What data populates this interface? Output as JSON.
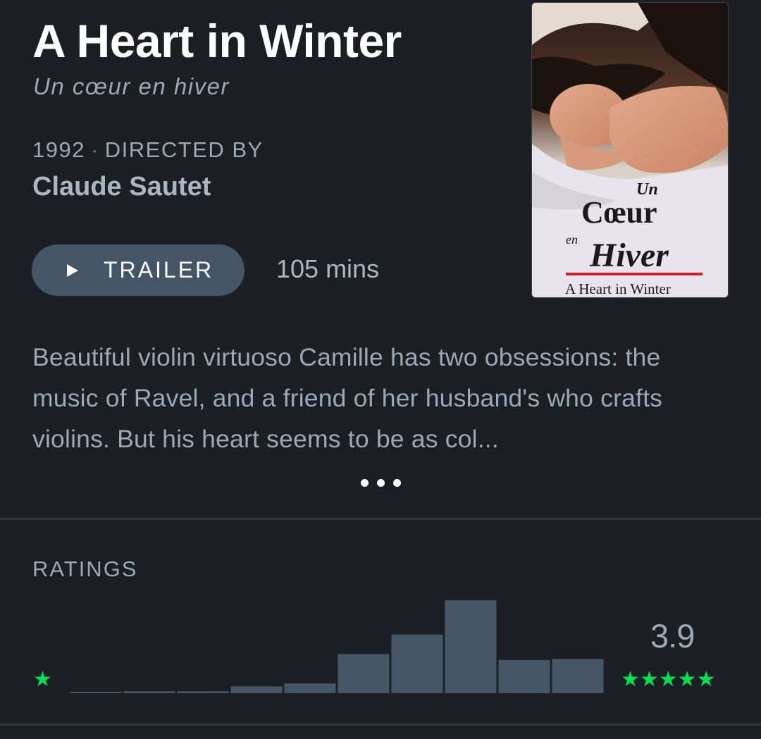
{
  "film": {
    "title": "A Heart in Winter",
    "original_title": "Un cœur en hiver",
    "year": "1992",
    "directed_by_label": "DIRECTED BY",
    "director": "Claude Sautet",
    "trailer_label": "TRAILER",
    "runtime": "105 mins",
    "synopsis": "Beautiful violin virtuoso Camille has two obsessions: the music of Ravel, and a friend of her husband's who crafts violins. But his heart seems to be as col...",
    "poster": {
      "line_un": "Un",
      "line_coeur": "Cœur",
      "line_en": "en",
      "line_hiver": "Hiver",
      "line_english": "A Heart in Winter"
    }
  },
  "ratings": {
    "label": "RATINGS",
    "average": "3.9",
    "low_star": "★",
    "high_stars": "★★★★★",
    "star_color": "#00e054",
    "bar_color": "#445566"
  },
  "chart_data": {
    "type": "bar",
    "categories": [
      "0.5",
      "1",
      "1.5",
      "2",
      "2.5",
      "3",
      "3.5",
      "4",
      "4.5",
      "5"
    ],
    "values": [
      1,
      2,
      2,
      7,
      10,
      40,
      60,
      95,
      34,
      35
    ],
    "ylim": [
      0,
      95
    ]
  },
  "icons": {
    "play": "play-icon",
    "more": "ellipsis-icon",
    "star": "star-icon"
  }
}
